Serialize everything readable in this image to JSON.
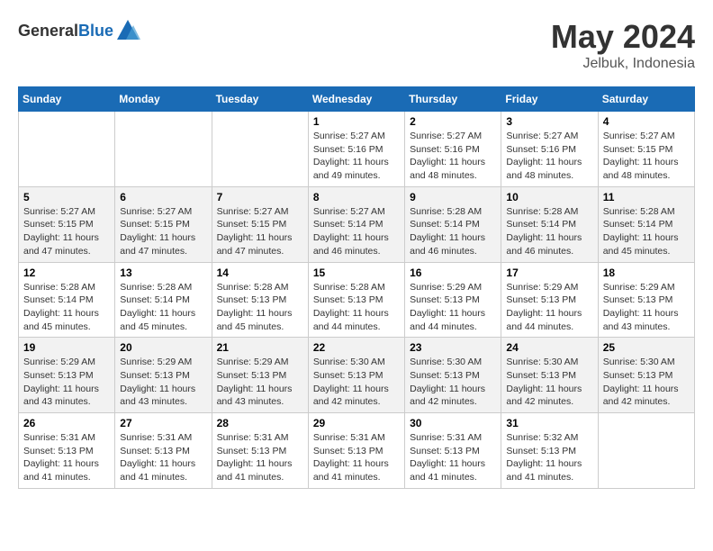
{
  "logo": {
    "text_general": "General",
    "text_blue": "Blue"
  },
  "title": {
    "month_year": "May 2024",
    "location": "Jelbuk, Indonesia"
  },
  "weekdays": [
    "Sunday",
    "Monday",
    "Tuesday",
    "Wednesday",
    "Thursday",
    "Friday",
    "Saturday"
  ],
  "weeks": [
    [
      {
        "day": null,
        "info": null
      },
      {
        "day": null,
        "info": null
      },
      {
        "day": null,
        "info": null
      },
      {
        "day": "1",
        "info": "Sunrise: 5:27 AM\nSunset: 5:16 PM\nDaylight: 11 hours\nand 49 minutes."
      },
      {
        "day": "2",
        "info": "Sunrise: 5:27 AM\nSunset: 5:16 PM\nDaylight: 11 hours\nand 48 minutes."
      },
      {
        "day": "3",
        "info": "Sunrise: 5:27 AM\nSunset: 5:16 PM\nDaylight: 11 hours\nand 48 minutes."
      },
      {
        "day": "4",
        "info": "Sunrise: 5:27 AM\nSunset: 5:15 PM\nDaylight: 11 hours\nand 48 minutes."
      }
    ],
    [
      {
        "day": "5",
        "info": "Sunrise: 5:27 AM\nSunset: 5:15 PM\nDaylight: 11 hours\nand 47 minutes."
      },
      {
        "day": "6",
        "info": "Sunrise: 5:27 AM\nSunset: 5:15 PM\nDaylight: 11 hours\nand 47 minutes."
      },
      {
        "day": "7",
        "info": "Sunrise: 5:27 AM\nSunset: 5:15 PM\nDaylight: 11 hours\nand 47 minutes."
      },
      {
        "day": "8",
        "info": "Sunrise: 5:27 AM\nSunset: 5:14 PM\nDaylight: 11 hours\nand 46 minutes."
      },
      {
        "day": "9",
        "info": "Sunrise: 5:28 AM\nSunset: 5:14 PM\nDaylight: 11 hours\nand 46 minutes."
      },
      {
        "day": "10",
        "info": "Sunrise: 5:28 AM\nSunset: 5:14 PM\nDaylight: 11 hours\nand 46 minutes."
      },
      {
        "day": "11",
        "info": "Sunrise: 5:28 AM\nSunset: 5:14 PM\nDaylight: 11 hours\nand 45 minutes."
      }
    ],
    [
      {
        "day": "12",
        "info": "Sunrise: 5:28 AM\nSunset: 5:14 PM\nDaylight: 11 hours\nand 45 minutes."
      },
      {
        "day": "13",
        "info": "Sunrise: 5:28 AM\nSunset: 5:14 PM\nDaylight: 11 hours\nand 45 minutes."
      },
      {
        "day": "14",
        "info": "Sunrise: 5:28 AM\nSunset: 5:13 PM\nDaylight: 11 hours\nand 45 minutes."
      },
      {
        "day": "15",
        "info": "Sunrise: 5:28 AM\nSunset: 5:13 PM\nDaylight: 11 hours\nand 44 minutes."
      },
      {
        "day": "16",
        "info": "Sunrise: 5:29 AM\nSunset: 5:13 PM\nDaylight: 11 hours\nand 44 minutes."
      },
      {
        "day": "17",
        "info": "Sunrise: 5:29 AM\nSunset: 5:13 PM\nDaylight: 11 hours\nand 44 minutes."
      },
      {
        "day": "18",
        "info": "Sunrise: 5:29 AM\nSunset: 5:13 PM\nDaylight: 11 hours\nand 43 minutes."
      }
    ],
    [
      {
        "day": "19",
        "info": "Sunrise: 5:29 AM\nSunset: 5:13 PM\nDaylight: 11 hours\nand 43 minutes."
      },
      {
        "day": "20",
        "info": "Sunrise: 5:29 AM\nSunset: 5:13 PM\nDaylight: 11 hours\nand 43 minutes."
      },
      {
        "day": "21",
        "info": "Sunrise: 5:29 AM\nSunset: 5:13 PM\nDaylight: 11 hours\nand 43 minutes."
      },
      {
        "day": "22",
        "info": "Sunrise: 5:30 AM\nSunset: 5:13 PM\nDaylight: 11 hours\nand 42 minutes."
      },
      {
        "day": "23",
        "info": "Sunrise: 5:30 AM\nSunset: 5:13 PM\nDaylight: 11 hours\nand 42 minutes."
      },
      {
        "day": "24",
        "info": "Sunrise: 5:30 AM\nSunset: 5:13 PM\nDaylight: 11 hours\nand 42 minutes."
      },
      {
        "day": "25",
        "info": "Sunrise: 5:30 AM\nSunset: 5:13 PM\nDaylight: 11 hours\nand 42 minutes."
      }
    ],
    [
      {
        "day": "26",
        "info": "Sunrise: 5:31 AM\nSunset: 5:13 PM\nDaylight: 11 hours\nand 41 minutes."
      },
      {
        "day": "27",
        "info": "Sunrise: 5:31 AM\nSunset: 5:13 PM\nDaylight: 11 hours\nand 41 minutes."
      },
      {
        "day": "28",
        "info": "Sunrise: 5:31 AM\nSunset: 5:13 PM\nDaylight: 11 hours\nand 41 minutes."
      },
      {
        "day": "29",
        "info": "Sunrise: 5:31 AM\nSunset: 5:13 PM\nDaylight: 11 hours\nand 41 minutes."
      },
      {
        "day": "30",
        "info": "Sunrise: 5:31 AM\nSunset: 5:13 PM\nDaylight: 11 hours\nand 41 minutes."
      },
      {
        "day": "31",
        "info": "Sunrise: 5:32 AM\nSunset: 5:13 PM\nDaylight: 11 hours\nand 41 minutes."
      },
      {
        "day": null,
        "info": null
      }
    ]
  ]
}
